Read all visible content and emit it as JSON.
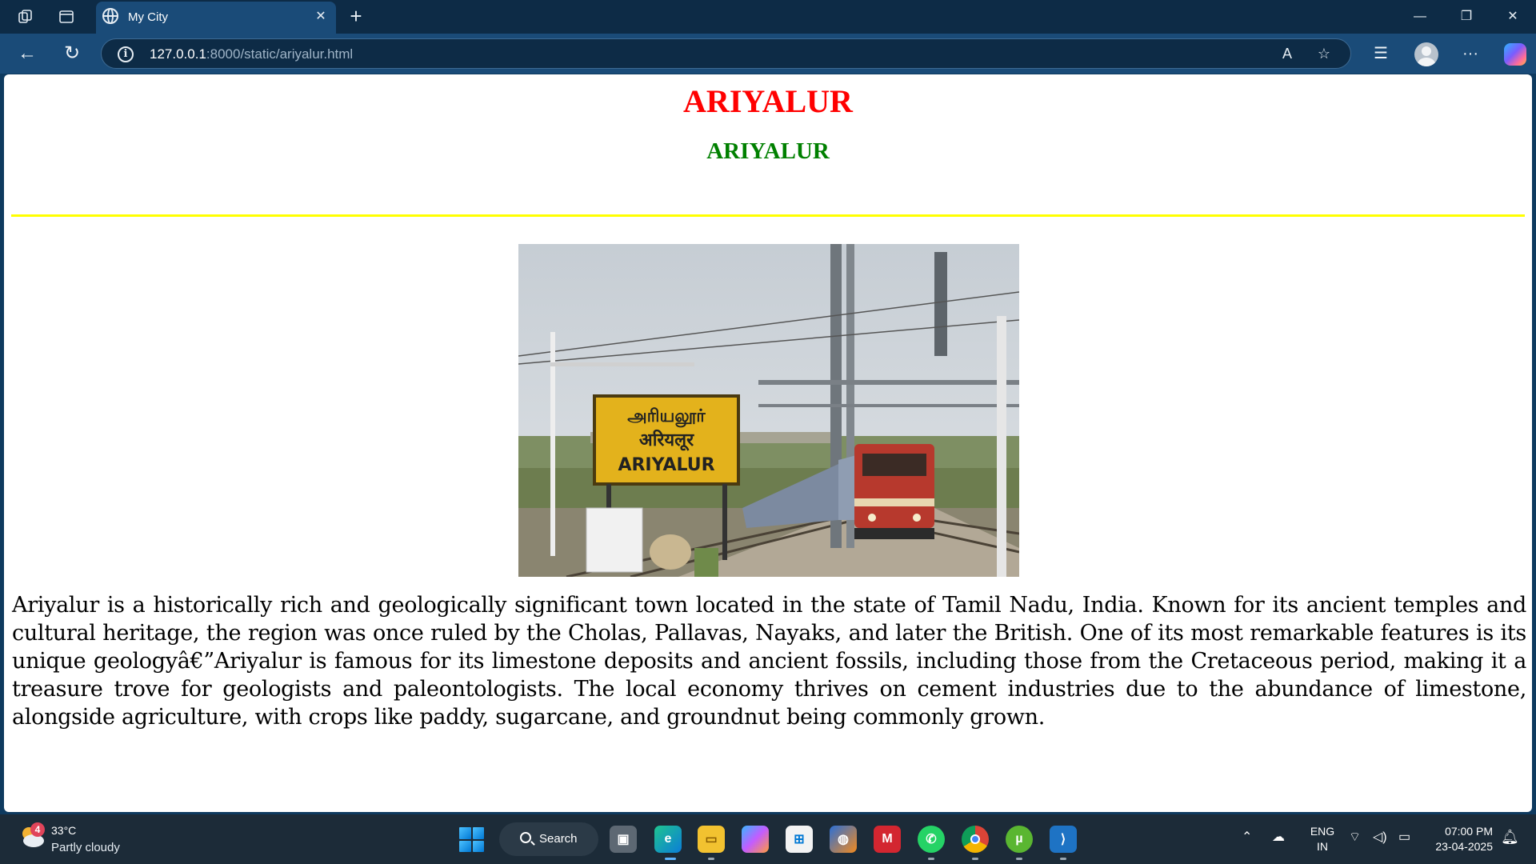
{
  "browser": {
    "tab_title": "My City",
    "url_host": "127.0.0.1",
    "url_rest": ":8000/static/ariyalur.html"
  },
  "page": {
    "heading1": "ARIYALUR",
    "heading2": "ARIYALUR",
    "image_alt": "Ariyalur railway station",
    "sign_tamil": "அரியலூர்",
    "sign_hindi": "अरियलूर",
    "sign_english": "ARIYALUR",
    "description": "Ariyalur is a historically rich and geologically significant town located in the state of Tamil Nadu, India. Known for its ancient temples and cultural heritage, the region was once ruled by the Cholas, Pallavas, Nayaks, and later the British. One of its most remarkable features is its unique geologyâ€”Ariyalur is famous for its limestone deposits and ancient fossils, including those from the Cretaceous period, making it a treasure trove for geologists and paleontologists. The local economy thrives on cement industries due to the abundance of limestone, alongside agriculture, with crops like paddy, sugarcane, and groundnut being commonly grown."
  },
  "taskbar": {
    "weather_badge": "4",
    "weather_temp": "33°C",
    "weather_condition": "Partly cloudy",
    "search_label": "Search",
    "lang_top": "ENG",
    "lang_bottom": "IN",
    "time": "07:00 PM",
    "date": "23-04-2025"
  }
}
